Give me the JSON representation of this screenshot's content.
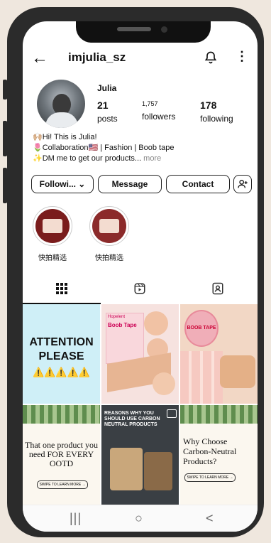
{
  "profile": {
    "username": "imjulia_sz",
    "display_name": "Julia",
    "posts_count": "21",
    "posts_label": "posts",
    "followers_count": "1,757",
    "followers_label": "followers",
    "following_count": "178",
    "following_label": "following",
    "bio_line1": "🙌🏼Hi! This is Julia!",
    "bio_line2": "🌷Collaboration🇺🇸 | Fashion | Boob tape",
    "bio_line3": "✨DM me to get our products...",
    "bio_more": " more"
  },
  "actions": {
    "following_label": "Followi... ⌄",
    "message_label": "Message",
    "contact_label": "Contact"
  },
  "highlights": [
    {
      "label": "快拍精选"
    },
    {
      "label": "快拍精选"
    }
  ],
  "grid": {
    "post1_title": "ATTENTION PLEASE",
    "post1_warn": "⚠️⚠️⚠️⚠️⚠️",
    "post2_brand": "Hopelent",
    "post2_title": "Boob Tape",
    "post3_title": "BOOB TAPE",
    "post4_title": "That one product you need FOR EVERY OOTD",
    "post4_cta": "SWIPE TO LEARN MORE →",
    "post5_title": "REASONS WHY YOU SHOULD USE CARBON NEUTRAL PRODUCTS",
    "post6_title": "Why Choose Carbon-Neutral Products?",
    "post6_cta": "SWIPE TO LEARN MORE →"
  },
  "icons": {
    "back": "arrow-left-icon",
    "bell": "bell-icon",
    "more": "more-vertical-icon",
    "add_user": "add-user-icon",
    "grid_tab": "grid-icon",
    "reels_tab": "reels-icon",
    "tagged_tab": "tagged-icon"
  },
  "nav": {
    "recents": "|||",
    "home": "○",
    "back": "<"
  }
}
